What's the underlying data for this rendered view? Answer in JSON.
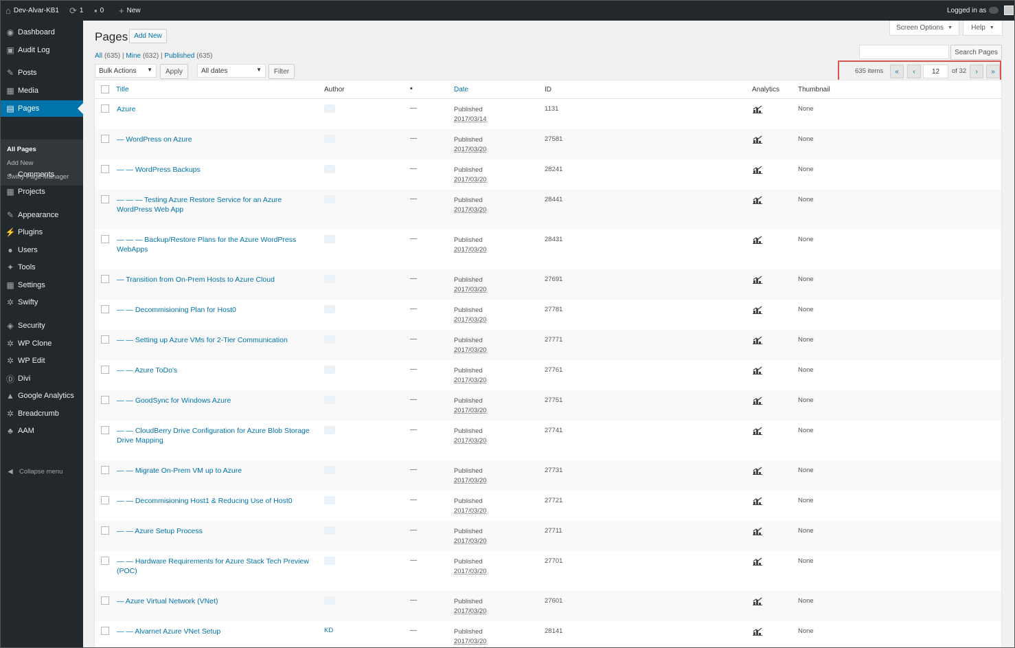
{
  "adminbar": {
    "site_name": "Dev-Alvar-KB1",
    "updates_count": "1",
    "comments_count": "0",
    "new_label": "New",
    "logged_in_label": "Logged in as"
  },
  "sidebar": {
    "items": [
      {
        "icon": "dashboard-icon",
        "glyph": "◉",
        "label": "Dashboard"
      },
      {
        "icon": "audit-log-icon",
        "glyph": "▣",
        "label": "Audit Log"
      },
      {
        "icon": "posts-icon",
        "glyph": "✎",
        "label": "Posts"
      },
      {
        "icon": "media-icon",
        "glyph": "▦",
        "label": "Media"
      },
      {
        "icon": "pages-icon",
        "glyph": "▤",
        "label": "Pages"
      },
      {
        "icon": "comments-icon",
        "glyph": "▪",
        "label": "Comments"
      },
      {
        "icon": "projects-icon",
        "glyph": "▦",
        "label": "Projects"
      },
      {
        "icon": "appearance-icon",
        "glyph": "✎",
        "label": "Appearance"
      },
      {
        "icon": "plugins-icon",
        "glyph": "⚡",
        "label": "Plugins"
      },
      {
        "icon": "users-icon",
        "glyph": "●",
        "label": "Users"
      },
      {
        "icon": "tools-icon",
        "glyph": "✦",
        "label": "Tools"
      },
      {
        "icon": "settings-icon",
        "glyph": "▦",
        "label": "Settings"
      },
      {
        "icon": "swifty-icon",
        "glyph": "✲",
        "label": "Swifty"
      },
      {
        "icon": "security-icon",
        "glyph": "◈",
        "label": "Security"
      },
      {
        "icon": "wp-clone-icon",
        "glyph": "✲",
        "label": "WP Clone"
      },
      {
        "icon": "wp-edit-icon",
        "glyph": "✲",
        "label": "WP Edit"
      },
      {
        "icon": "divi-icon",
        "glyph": "Ⓓ",
        "label": "Divi"
      },
      {
        "icon": "google-analytics-icon",
        "glyph": "▲",
        "label": "Google Analytics"
      },
      {
        "icon": "breadcrumb-icon",
        "glyph": "✲",
        "label": "Breadcrumb"
      },
      {
        "icon": "aam-icon",
        "glyph": "♣",
        "label": "AAM"
      }
    ],
    "submenu": [
      "All Pages",
      "Add New",
      "Swifty Page Manager"
    ],
    "collapse_label": "Collapse menu"
  },
  "header": {
    "title": "Pages",
    "add_new": "Add New",
    "screen_options": "Screen Options",
    "help": "Help"
  },
  "filters": {
    "all": "All",
    "all_count": "(635)",
    "mine": "Mine",
    "mine_count": "(632)",
    "published": "Published",
    "published_count": "(635)",
    "bulk_actions": "Bulk Actions",
    "apply": "Apply",
    "all_dates": "All dates",
    "filter": "Filter",
    "search_button": "Search Pages",
    "search_value": ""
  },
  "pagination": {
    "items": "635 items",
    "first": "«",
    "prev": "‹",
    "current_page": "12",
    "of_total": "of 32",
    "next": "›",
    "last": "»"
  },
  "table": {
    "columns": {
      "title": "Title",
      "author": "Author",
      "date": "Date",
      "id": "ID",
      "analytics": "Analytics",
      "thumbnail": "Thumbnail"
    },
    "rows": [
      {
        "title": "Azure",
        "author": "",
        "comments": "—",
        "status": "Published",
        "date": "2017/03/14",
        "id": "1131",
        "thumbnail": "None"
      },
      {
        "title": "— WordPress on Azure",
        "author": "",
        "comments": "—",
        "status": "Published",
        "date": "2017/03/20",
        "id": "27581",
        "thumbnail": "None"
      },
      {
        "title": "— — WordPress Backups",
        "author": "",
        "comments": "—",
        "status": "Published",
        "date": "2017/03/20",
        "id": "28241",
        "thumbnail": "None"
      },
      {
        "title": "— — — Testing Azure Restore Service for an Azure WordPress Web App",
        "author": "",
        "comments": "—",
        "status": "Published",
        "date": "2017/03/20",
        "id": "28441",
        "thumbnail": "None"
      },
      {
        "title": "— — — Backup/Restore Plans for the Azure WordPress WebApps",
        "author": "",
        "comments": "—",
        "status": "Published",
        "date": "2017/03/20",
        "id": "28431",
        "thumbnail": "None"
      },
      {
        "title": "— Transition from On-Prem Hosts to Azure Cloud",
        "author": "",
        "comments": "—",
        "status": "Published",
        "date": "2017/03/20",
        "id": "27691",
        "thumbnail": "None"
      },
      {
        "title": "— — Decommisioning Plan for Host0",
        "author": "",
        "comments": "—",
        "status": "Published",
        "date": "2017/03/20",
        "id": "27781",
        "thumbnail": "None"
      },
      {
        "title": "— — Setting up Azure VMs for 2-Tier Communication",
        "author": "",
        "comments": "—",
        "status": "Published",
        "date": "2017/03/20",
        "id": "27771",
        "thumbnail": "None"
      },
      {
        "title": "— — Azure ToDo's",
        "author": "",
        "comments": "—",
        "status": "Published",
        "date": "2017/03/20",
        "id": "27761",
        "thumbnail": "None"
      },
      {
        "title": "— — GoodSync for Windows Azure",
        "author": "",
        "comments": "—",
        "status": "Published",
        "date": "2017/03/20",
        "id": "27751",
        "thumbnail": "None"
      },
      {
        "title": "— — CloudBerry Drive Configuration for Azure Blob Storage Drive Mapping",
        "author": "",
        "comments": "—",
        "status": "Published",
        "date": "2017/03/20",
        "id": "27741",
        "thumbnail": "None"
      },
      {
        "title": "— — Migrate On-Prem VM up to Azure",
        "author": "",
        "comments": "—",
        "status": "Published",
        "date": "2017/03/20",
        "id": "27731",
        "thumbnail": "None"
      },
      {
        "title": "— — Decommisioning Host1 & Reducing Use of Host0",
        "author": "",
        "comments": "—",
        "status": "Published",
        "date": "2017/03/20",
        "id": "27721",
        "thumbnail": "None"
      },
      {
        "title": "— — Azure Setup Process",
        "author": "",
        "comments": "—",
        "status": "Published",
        "date": "2017/03/20",
        "id": "27711",
        "thumbnail": "None"
      },
      {
        "title": "— — Hardware Requirements for Azure Stack Tech Preview (POC)",
        "author": "",
        "comments": "—",
        "status": "Published",
        "date": "2017/03/20",
        "id": "27701",
        "thumbnail": "None"
      },
      {
        "title": "— Azure Virtual Network (VNet)",
        "author": "",
        "comments": "—",
        "status": "Published",
        "date": "2017/03/20",
        "id": "27601",
        "thumbnail": "None"
      },
      {
        "title": "— — Alvarnet Azure VNet Setup",
        "author": "KD",
        "comments": "—",
        "status": "Published",
        "date": "2017/03/20",
        "id": "28141",
        "thumbnail": "None"
      }
    ]
  },
  "colors": {
    "accent": "#0073aa",
    "sidebar_bg": "#23282d",
    "highlight_border": "#d9534f"
  }
}
